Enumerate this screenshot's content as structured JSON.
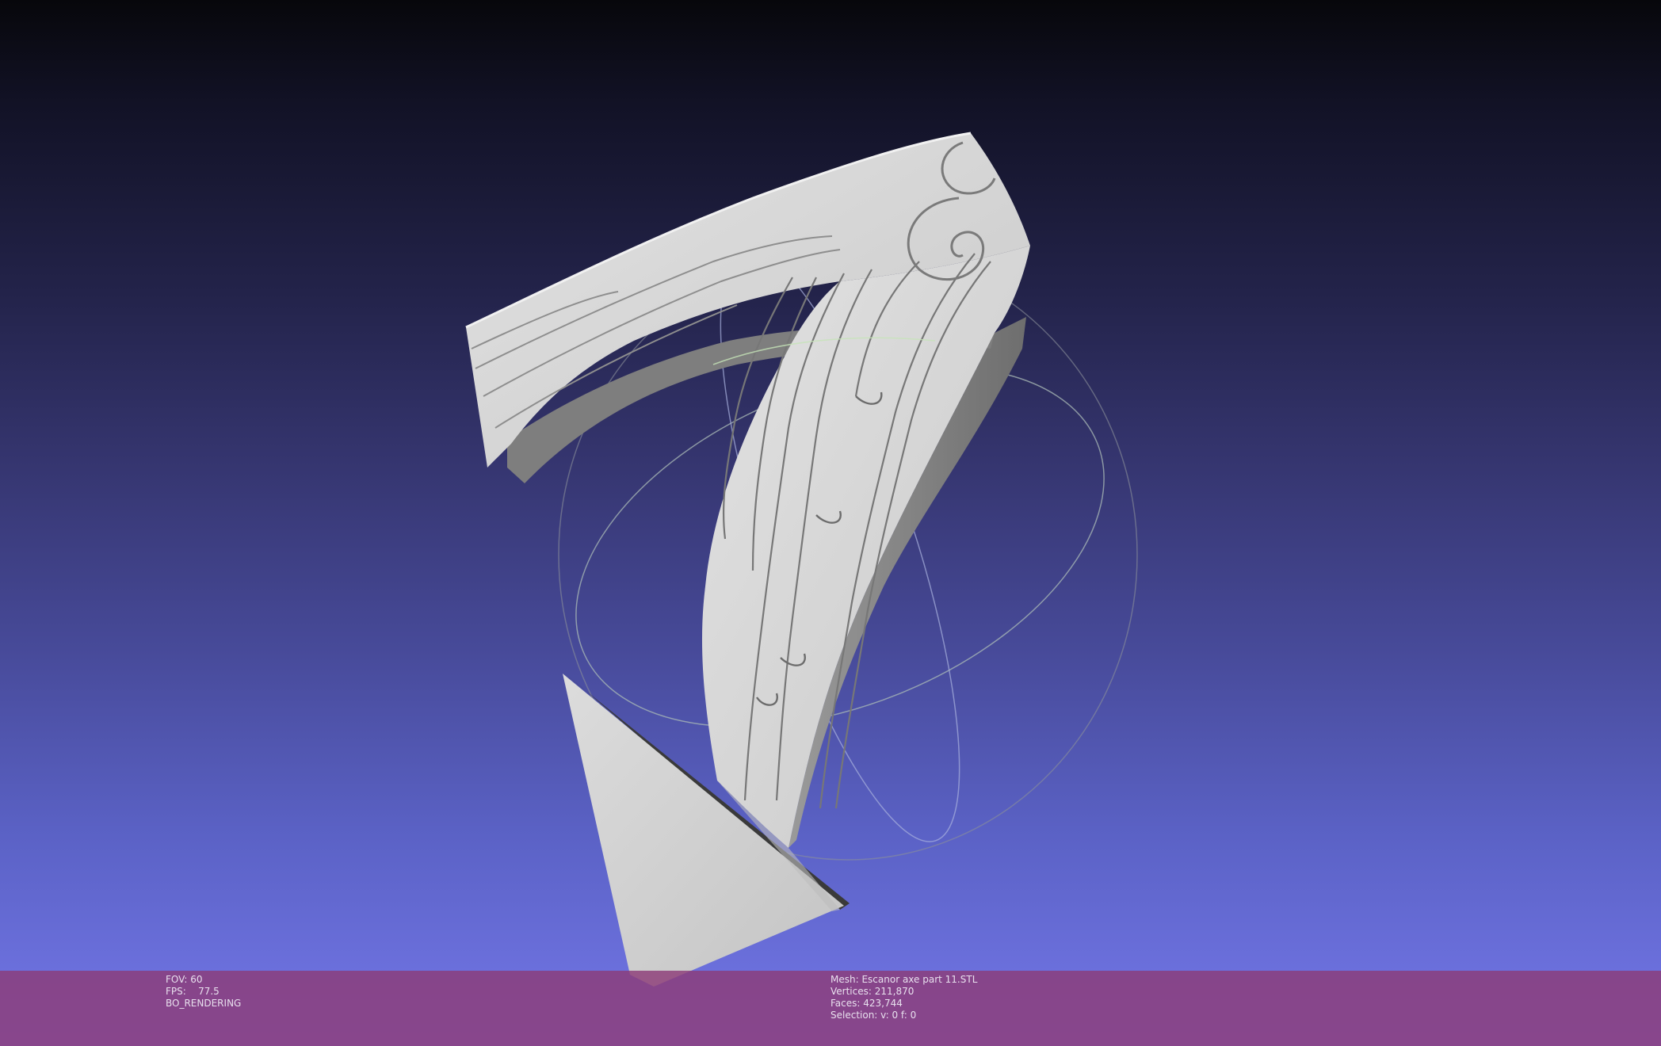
{
  "viewer": {
    "fov_label": "FOV:",
    "fov_value": "60",
    "fps_label": "FPS:",
    "fps_value": "77.5",
    "render_mode": "BO_RENDERING"
  },
  "mesh_info": {
    "mesh_label": "Mesh:",
    "mesh_name": "Escanor axe part 11.STL",
    "vertices_label": "Vertices:",
    "vertices": "211,870",
    "faces_label": "Faces:",
    "faces": "423,744",
    "selection_label": "Selection:",
    "selection": "v: 0 f: 0"
  },
  "colors": {
    "background_top": "#07070b",
    "background_bottom": "#7477e8",
    "info_bar": "#8c3c78",
    "mesh_light": "#d8d8d8",
    "mesh_shadow": "#8a8a8a"
  }
}
